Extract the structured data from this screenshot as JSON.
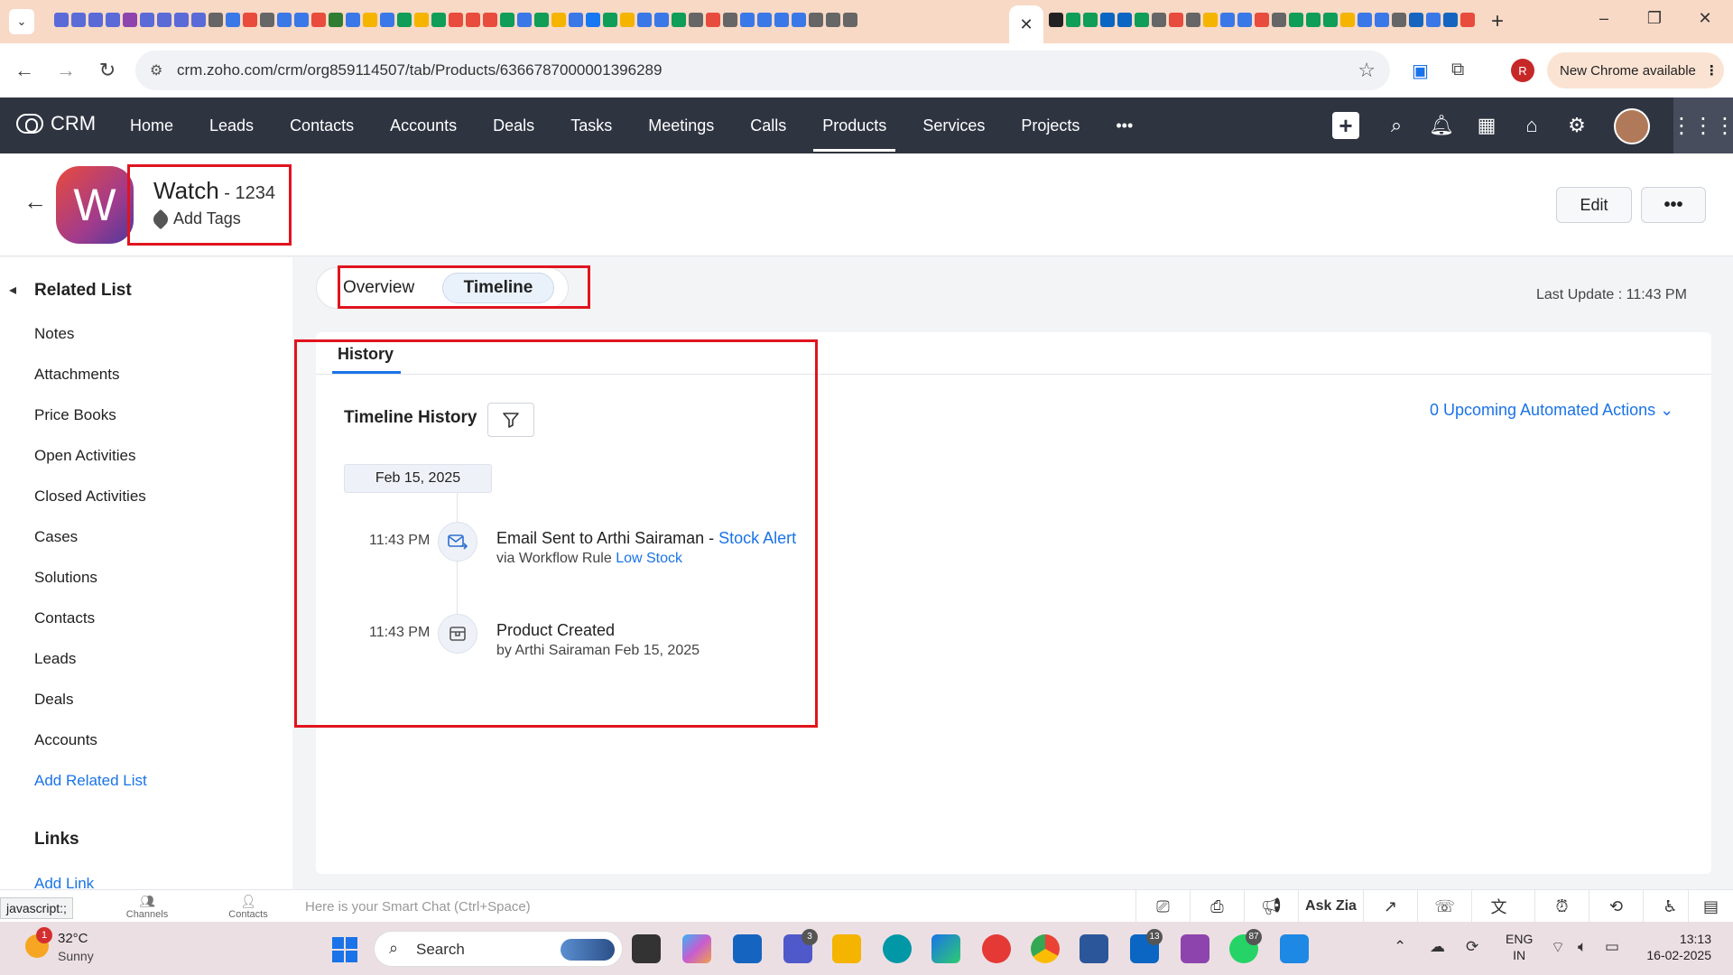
{
  "browser": {
    "url": "crm.zoho.com/crm/org859114507/tab/Products/6366787000001396289",
    "profile_initial": "R",
    "new_chrome_label": "New Chrome available"
  },
  "crm_nav": {
    "brand": "CRM",
    "items": [
      "Home",
      "Leads",
      "Contacts",
      "Accounts",
      "Deals",
      "Tasks",
      "Meetings",
      "Calls",
      "Products",
      "Services",
      "Projects"
    ],
    "active": "Products",
    "more": "•••"
  },
  "record": {
    "avatar_letter": "W",
    "name": "Watch",
    "code": " - 1234",
    "add_tags": "Add Tags",
    "edit_label": "Edit",
    "more_label": "•••"
  },
  "sidebar": {
    "heading": "Related List",
    "items": [
      "Notes",
      "Attachments",
      "Price Books",
      "Open Activities",
      "Closed Activities",
      "Cases",
      "Solutions",
      "Contacts",
      "Leads",
      "Deals",
      "Accounts"
    ],
    "add_related": "Add Related List",
    "links_heading": "Links",
    "add_link": "Add Link"
  },
  "view_tabs": {
    "overview": "Overview",
    "timeline": "Timeline",
    "active": "Timeline"
  },
  "last_update": "Last Update : 11:43 PM",
  "history": {
    "tab_label": "History",
    "title": "Timeline History",
    "upcoming": "0 Upcoming Automated Actions",
    "date": "Feb 15, 2025",
    "events": [
      {
        "time": "11:43 PM",
        "icon": "email-icon",
        "title_prefix": "Email Sent to Arthi Sairaman",
        "title_sep": " - ",
        "title_link": "Stock Alert",
        "sub_prefix": "via Workflow Rule ",
        "sub_link": "Low Stock"
      },
      {
        "time": "11:43 PM",
        "icon": "product-icon",
        "title_prefix": "Product Created",
        "sub_prefix": "by Arthi Sairaman Feb 15, 2025"
      }
    ]
  },
  "chatbar": {
    "status": "javascript:;",
    "channels": "Channels",
    "contacts": "Contacts",
    "placeholder": "Here is your Smart Chat (Ctrl+Space)",
    "ask_zia": "Ask Zia"
  },
  "taskbar": {
    "weather_badge": "1",
    "temp": "32°C",
    "condition": "Sunny",
    "search": "Search",
    "teams_badge": "3",
    "linkedin_badge": "13",
    "whatsapp_badge": "87",
    "lang_1": "ENG",
    "lang_2": "IN",
    "time": "13:13",
    "date": "16-02-2025"
  }
}
